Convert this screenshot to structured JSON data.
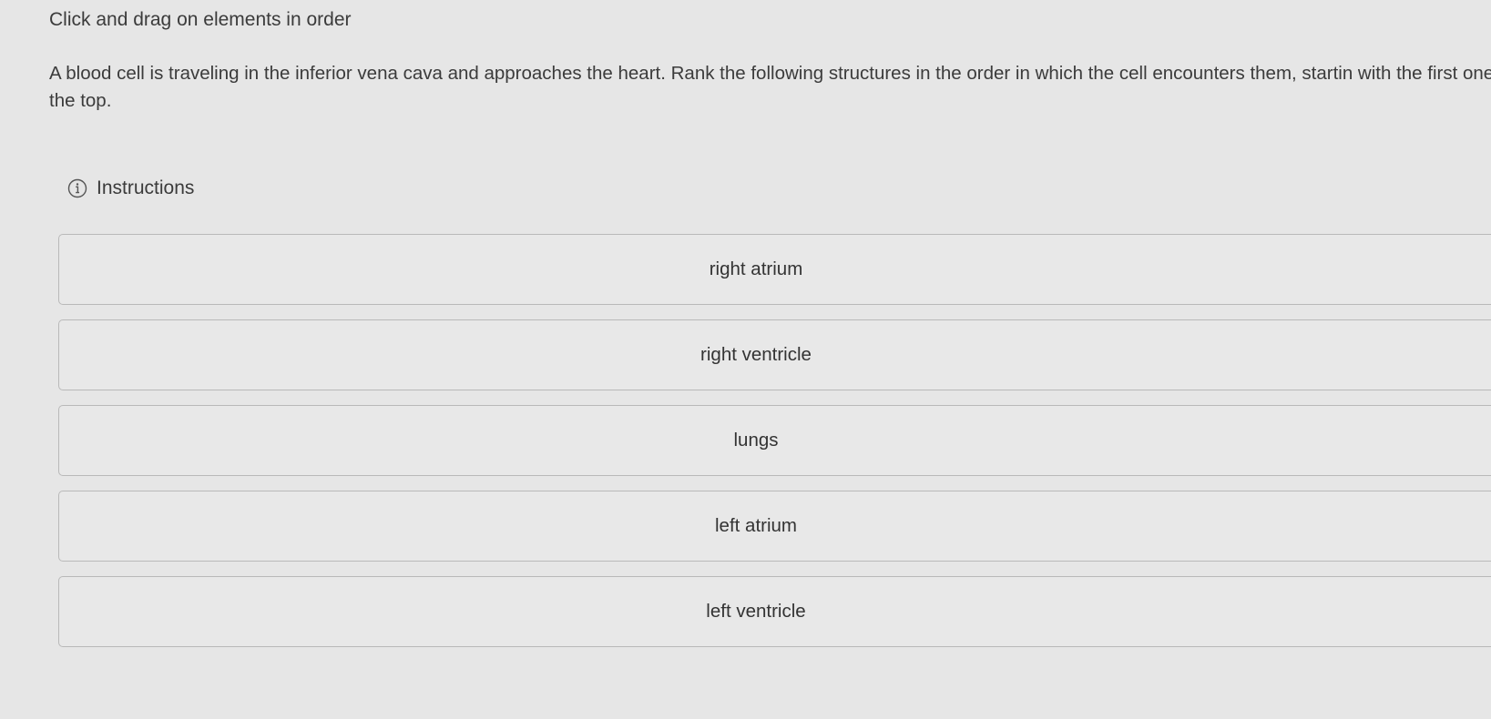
{
  "heading": "Click and drag on elements in order",
  "question": "A blood cell is traveling in the inferior vena cava and approaches the heart. Rank the following structures in the order in which the cell encounters them, startin with the first one at the top.",
  "instructions": {
    "label": "Instructions",
    "icon": "info-icon"
  },
  "items": [
    {
      "label": "right atrium"
    },
    {
      "label": "right ventricle"
    },
    {
      "label": "lungs"
    },
    {
      "label": "left atrium"
    },
    {
      "label": "left ventricle"
    }
  ]
}
